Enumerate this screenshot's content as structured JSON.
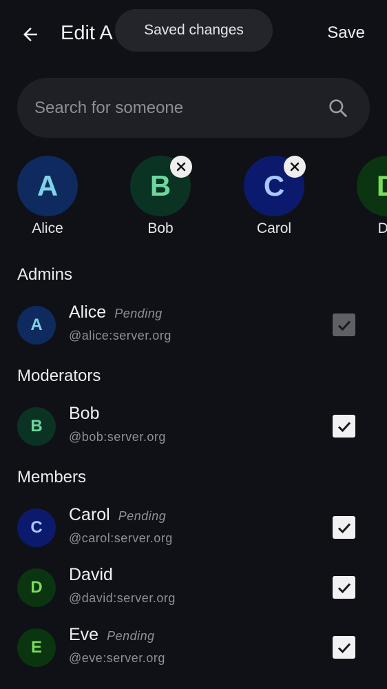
{
  "header": {
    "title": "Edit A",
    "save_label": "Save",
    "toast": "Saved changes"
  },
  "search": {
    "placeholder": "Search for someone",
    "value": ""
  },
  "selected": [
    {
      "initial": "A",
      "name": "Alice",
      "removable": false,
      "bg": "#0e2a5f",
      "fg": "#7fd3e6"
    },
    {
      "initial": "B",
      "name": "Bob",
      "removable": true,
      "bg": "#0a3323",
      "fg": "#6ed6a0"
    },
    {
      "initial": "C",
      "name": "Carol",
      "removable": true,
      "bg": "#0c1a6e",
      "fg": "#a9c8ff"
    },
    {
      "initial": "D",
      "name": "Da",
      "removable": false,
      "bg": "#0b3410",
      "fg": "#7bdc5a"
    }
  ],
  "sections": {
    "admins": "Admins",
    "moderators": "Moderators",
    "members": "Members"
  },
  "people": {
    "alice": {
      "initial": "A",
      "name": "Alice",
      "status": "Pending",
      "handle": "@alice:server.org",
      "checked": true,
      "disabled": true,
      "bg": "#0e2a5f",
      "fg": "#7fd3e6"
    },
    "bob": {
      "initial": "B",
      "name": "Bob",
      "status": "",
      "handle": "@bob:server.org",
      "checked": true,
      "disabled": false,
      "bg": "#0a3323",
      "fg": "#6ed6a0"
    },
    "carol": {
      "initial": "C",
      "name": "Carol",
      "status": "Pending",
      "handle": "@carol:server.org",
      "checked": true,
      "disabled": false,
      "bg": "#0c1a6e",
      "fg": "#a9c8ff"
    },
    "david": {
      "initial": "D",
      "name": "David",
      "status": "",
      "handle": "@david:server.org",
      "checked": true,
      "disabled": false,
      "bg": "#0b3410",
      "fg": "#7bdc5a"
    },
    "eve": {
      "initial": "E",
      "name": "Eve",
      "status": "Pending",
      "handle": "@eve:server.org",
      "checked": true,
      "disabled": false,
      "bg": "#0b3410",
      "fg": "#7bdc5a"
    }
  },
  "colors": {
    "background": "#101116",
    "surface": "#1f2026",
    "toast": "#24252b",
    "muted_text": "#8f9097"
  }
}
